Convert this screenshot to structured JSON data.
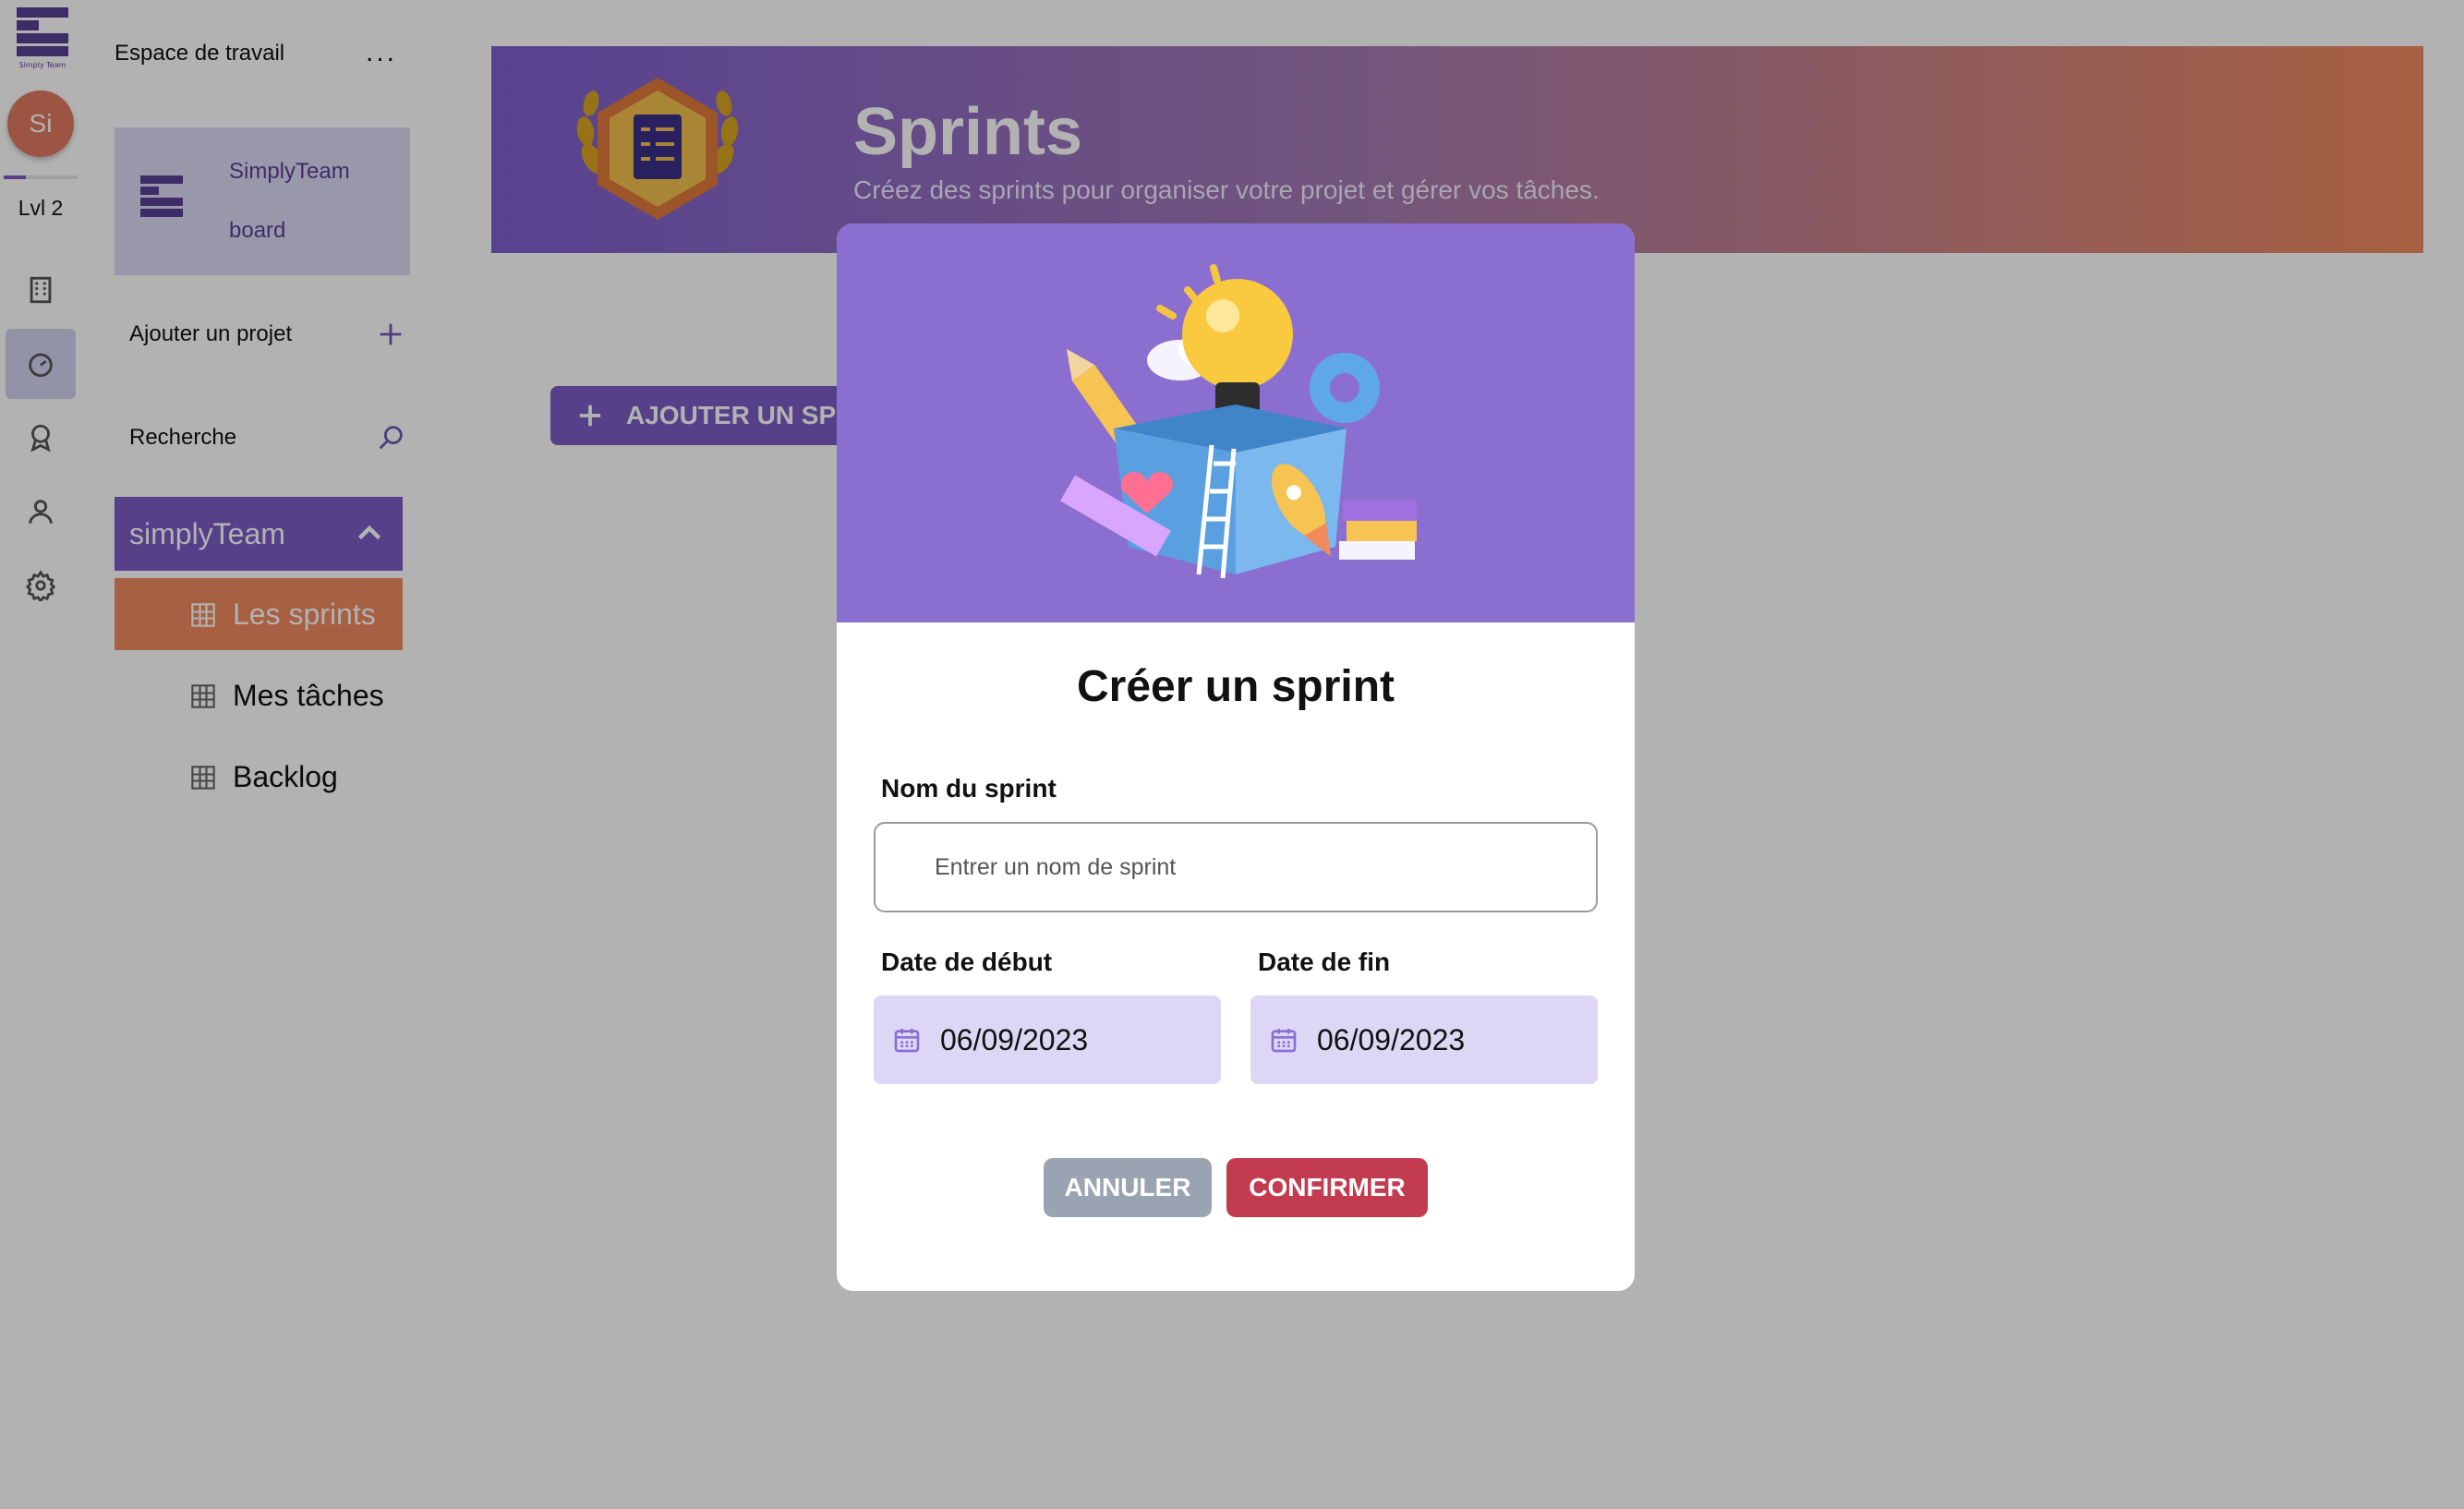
{
  "rail": {
    "logo_text": "Simply Team",
    "avatar_initials": "Si",
    "level_label": "Lvl 2",
    "xp_progress": 0.3,
    "icons": [
      "building-icon",
      "dashboard-icon",
      "award-icon",
      "user-icon",
      "settings-icon"
    ],
    "active_icon": "dashboard-icon"
  },
  "sidebar": {
    "workspace_title": "Espace de travail",
    "more_label": "...",
    "board": {
      "name": "SimplyTeam",
      "subtitle": "board"
    },
    "add_project_label": "Ajouter un projet",
    "search_label": "Recherche",
    "project": {
      "name": "simplyTeam"
    },
    "nav": [
      {
        "label": "Les sprints",
        "active": true
      },
      {
        "label": "Mes tâches",
        "active": false
      },
      {
        "label": "Backlog",
        "active": false
      }
    ]
  },
  "banner": {
    "title": "Sprints",
    "subtitle": "Créez des sprints pour organiser votre projet et gérer vos tâches."
  },
  "main": {
    "add_sprint_label": "AJOUTER UN SPRINT"
  },
  "modal": {
    "title": "Créer un sprint",
    "name_label": "Nom du sprint",
    "name_placeholder": "Entrer un nom de sprint",
    "name_value": "",
    "start_label": "Date de début",
    "end_label": "Date de fin",
    "start_value": "06/09/2023",
    "end_value": "06/09/2023",
    "cancel_label": "ANNULER",
    "confirm_label": "CONFIRMER"
  },
  "colors": {
    "brand_purple": "#7a5cc4",
    "accent_orange": "#f08a5d",
    "confirm_red": "#c23b4e",
    "cancel_gray": "#9aa3b2",
    "date_field_bg": "#ddd6f4",
    "overlay": "rgba(0,0,0,0.30)"
  }
}
